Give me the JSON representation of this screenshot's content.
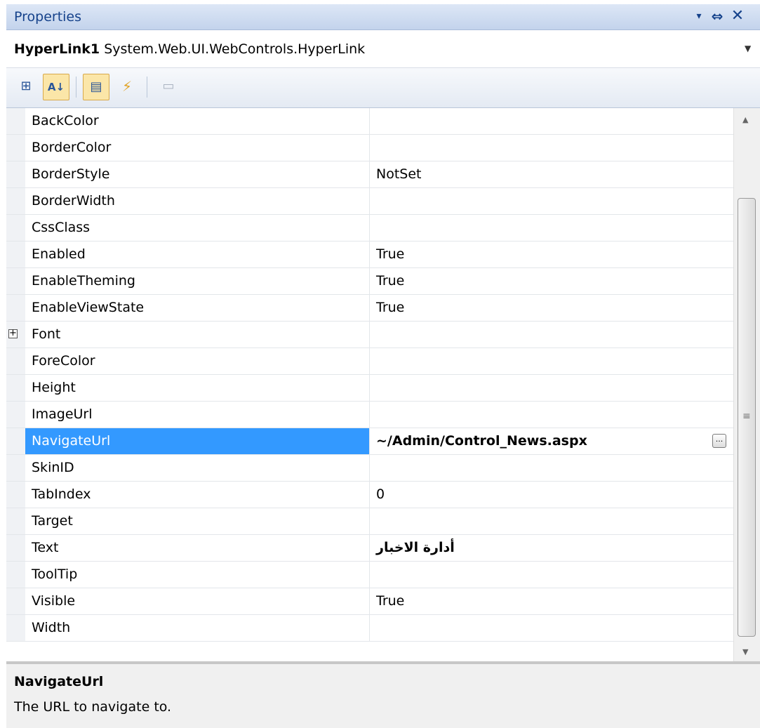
{
  "panel": {
    "title": "Properties"
  },
  "title_buttons": {
    "dropdown": "▾",
    "pin": "⇔",
    "close": "✕"
  },
  "selector": {
    "object_name": "HyperLink1",
    "object_type": "System.Web.UI.WebControls.HyperLink"
  },
  "toolbar": {
    "categorized": "⊞",
    "alphabetical": "A↓",
    "properties": "▤",
    "events": "⚡",
    "property_pages": "▭"
  },
  "properties": [
    {
      "name": "BackColor",
      "value": ""
    },
    {
      "name": "BorderColor",
      "value": ""
    },
    {
      "name": "BorderStyle",
      "value": "NotSet"
    },
    {
      "name": "BorderWidth",
      "value": ""
    },
    {
      "name": "CssClass",
      "value": ""
    },
    {
      "name": "Enabled",
      "value": "True"
    },
    {
      "name": "EnableTheming",
      "value": "True"
    },
    {
      "name": "EnableViewState",
      "value": "True"
    },
    {
      "name": "Font",
      "value": "",
      "expandable": true
    },
    {
      "name": "ForeColor",
      "value": ""
    },
    {
      "name": "Height",
      "value": ""
    },
    {
      "name": "ImageUrl",
      "value": ""
    },
    {
      "name": "NavigateUrl",
      "value": "~/Admin/Control_News.aspx",
      "selected": true
    },
    {
      "name": "SkinID",
      "value": ""
    },
    {
      "name": "TabIndex",
      "value": "0"
    },
    {
      "name": "Target",
      "value": ""
    },
    {
      "name": "Text",
      "value": "أدارة الاخبار"
    },
    {
      "name": "ToolTip",
      "value": ""
    },
    {
      "name": "Visible",
      "value": "True"
    },
    {
      "name": "Width",
      "value": ""
    }
  ],
  "description": {
    "title": "NavigateUrl",
    "text": "The URL to navigate to."
  },
  "colors": {
    "selection": "#3399ff",
    "title_bar": "#c3d3ec",
    "title_text": "#15428b"
  }
}
